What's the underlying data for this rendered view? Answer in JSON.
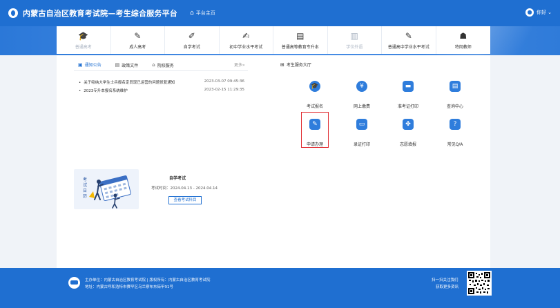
{
  "header": {
    "title": "内蒙古自治区教育考试院—考生综合服务平台",
    "home_label": "平台主页",
    "user_label": "你好"
  },
  "categories": [
    {
      "label": "普通高考",
      "icon": "graduation-icon",
      "glyph": "🎓",
      "enabled": false
    },
    {
      "label": "成人高考",
      "icon": "pen-icon",
      "glyph": "✎",
      "enabled": true
    },
    {
      "label": "自学考试",
      "icon": "edit-book-icon",
      "glyph": "✐",
      "enabled": true
    },
    {
      "label": "初中学业水平考试",
      "icon": "edit-doc-icon",
      "glyph": "✍",
      "enabled": true
    },
    {
      "label": "普通高等教育专升本",
      "icon": "screen-icon",
      "glyph": "▤",
      "enabled": true
    },
    {
      "label": "学位外语",
      "icon": "screen-doc-icon",
      "glyph": "▥",
      "enabled": false
    },
    {
      "label": "普通高中学业水平考试",
      "icon": "edit-paper-icon",
      "glyph": "✎",
      "enabled": true
    },
    {
      "label": "特岗教师",
      "icon": "grad-cap-icon",
      "glyph": "☗",
      "enabled": true
    }
  ],
  "tabs": [
    {
      "label": "通知公告",
      "icon": "notice-icon",
      "glyph": "▣"
    },
    {
      "label": "政策文件",
      "icon": "file-icon",
      "glyph": "▤"
    },
    {
      "label": "院校服务",
      "icon": "building-icon",
      "glyph": "⌂"
    }
  ],
  "more_label": "更多»",
  "news": [
    {
      "title": "关于吸纳大学生士兵报名定员现已运营的问题修复通知",
      "date": "2023-03-07 09:45:36"
    },
    {
      "title": "2023专升本报名系统维护",
      "date": "2023-02-15 11:29:35"
    }
  ],
  "services_title": "考生服务大厅",
  "services": [
    {
      "label": "考试报名",
      "icon": "graduation-cap-icon",
      "glyph": "🎓"
    },
    {
      "label": "网上缴费",
      "icon": "payment-icon",
      "glyph": "¥"
    },
    {
      "label": "准考证打印",
      "icon": "printer-icon",
      "glyph": "▬"
    },
    {
      "label": "查询中心",
      "icon": "search-doc-icon",
      "glyph": "▤"
    },
    {
      "label": "申请办理",
      "icon": "apply-edit-icon",
      "glyph": "✎"
    },
    {
      "label": "录证打印",
      "icon": "id-card-icon",
      "glyph": "▭"
    },
    {
      "label": "志愿填报",
      "icon": "clover-icon",
      "glyph": "✤"
    },
    {
      "label": "常见Q/A",
      "icon": "qa-icon",
      "glyph": "?"
    }
  ],
  "exam": {
    "side_text": "考试日历",
    "name": "自学考试",
    "time": "考试时间：2024.04.13 - 2024.04.14",
    "button": "查看考试科目"
  },
  "footer": {
    "line1": "主办单位：内蒙古自治区教育考试院 | 版权所有：内蒙古自治区教育考试院",
    "line2": "地址：内蒙古呼和浩特市赛罕区乌兰察布东街甲91号",
    "qr_line1": "扫一扫关注我们",
    "qr_line2": "获取更多资讯"
  },
  "colors": {
    "primary": "#1f6fd1",
    "highlight": "#e0262b"
  }
}
